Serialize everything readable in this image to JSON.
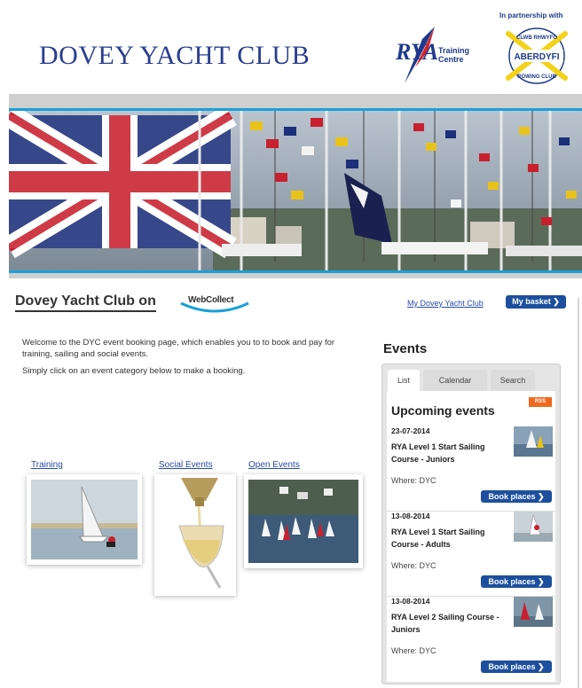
{
  "header": {
    "club_title": "DOVEY YACHT CLUB",
    "rya_mark": "RYA",
    "rya_sub_line1": "Training",
    "rya_sub_line2": "Centre",
    "partner_text": "In partnership with",
    "aberdyfi_main": "ABERDYFI",
    "aberdyfi_top": "CLWB RHWYFO",
    "aberdyfi_bottom": "ROWING CLUB"
  },
  "webcollect": {
    "heading": "Dovey Yacht Club on",
    "logo_text": "WebCollect",
    "my_link": "My Dovey Yacht Club",
    "basket": "My basket ❯"
  },
  "welcome": {
    "line1": "Welcome to the DYC event booking page, which enables you to to book and pay for training, sailing and social events.",
    "line2": "Simply click on an event category below to make a booking."
  },
  "categories": [
    {
      "label": "Training"
    },
    {
      "label": "Social Events"
    },
    {
      "label": "Open Events"
    }
  ],
  "events": {
    "title": "Events",
    "tabs": [
      "List",
      "Calendar",
      "Search"
    ],
    "upcoming": "Upcoming events",
    "rss": "RSS",
    "book_label": "Book places ❯",
    "items": [
      {
        "date": "23-07-2014",
        "name": "RYA Level 1 Start Sailing Course - Juniors",
        "where": "Where: DYC"
      },
      {
        "date": "13-08-2014",
        "name": "RYA Level 1 Start Sailing Course - Adults",
        "where": "Where: DYC"
      },
      {
        "date": "13-08-2014",
        "name": "RYA Level 2 Sailing Course - Juniors",
        "where": "Where: DYC"
      }
    ]
  },
  "colors": {
    "brand_blue": "#2a3d8f",
    "button_blue": "#1d4f9e",
    "banner_accent": "#1aa0d8",
    "rss_orange": "#f06a1e"
  }
}
